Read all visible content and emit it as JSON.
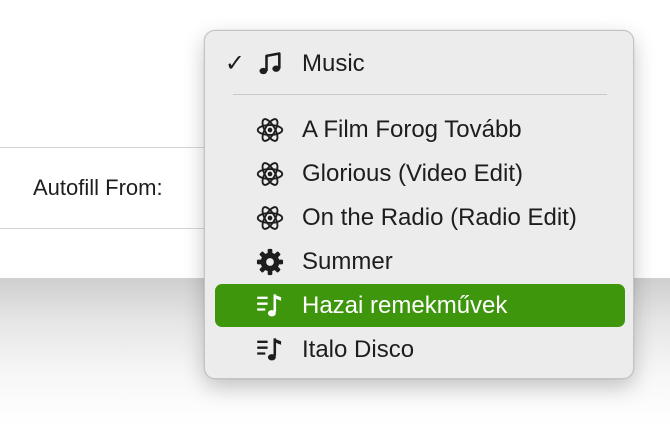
{
  "background": {
    "autofill_label": "Autofill From:"
  },
  "menu": {
    "checked_item": {
      "check": "✓",
      "icon": "music-note-icon",
      "label": "Music"
    },
    "items": [
      {
        "icon": "atom-icon",
        "label": "A Film Forog Tovább",
        "selected": false
      },
      {
        "icon": "atom-icon",
        "label": "Glorious (Video Edit)",
        "selected": false
      },
      {
        "icon": "atom-icon",
        "label": "On the Radio (Radio Edit)",
        "selected": false
      },
      {
        "icon": "gear-icon",
        "label": "Summer",
        "selected": false
      },
      {
        "icon": "playlist-icon",
        "label": "Hazai remekművek",
        "selected": true
      },
      {
        "icon": "playlist-icon",
        "label": "Italo Disco",
        "selected": false
      }
    ]
  },
  "colors": {
    "selection": "#3e960c",
    "menu_background": "#ececec"
  }
}
